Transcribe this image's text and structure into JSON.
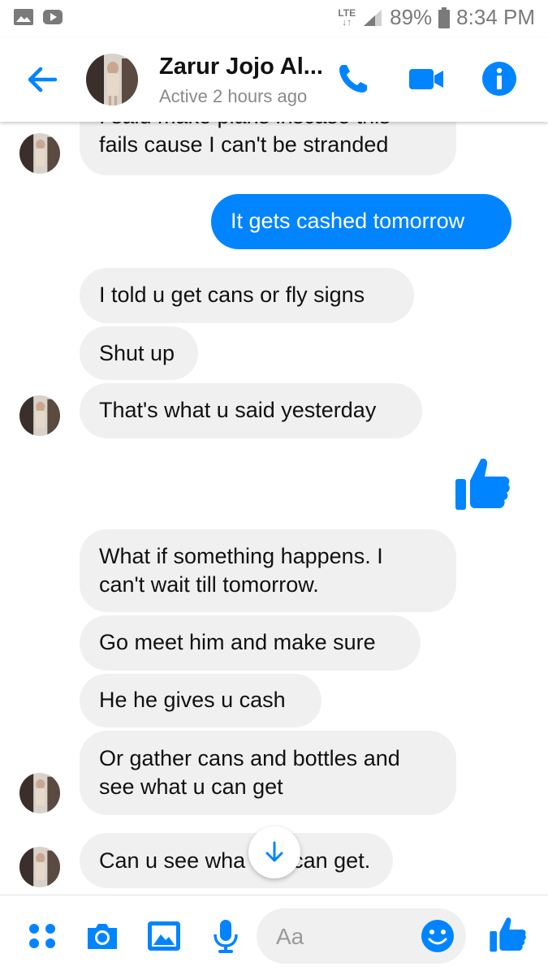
{
  "status_bar": {
    "network": "LTE",
    "battery": "89%",
    "time": "8:34 PM"
  },
  "header": {
    "name": "Zarur Jojo Al...",
    "status": "Active 2 hours ago"
  },
  "messages": [
    {
      "from": "them",
      "text": "I said make plans inscase this"
    },
    {
      "from": "them",
      "text": "fails cause I can't be stranded"
    },
    {
      "from": "me",
      "text": "It gets cashed tomorrow"
    },
    {
      "from": "them",
      "text": "I told u get cans or fly signs"
    },
    {
      "from": "them",
      "text": "Shut up"
    },
    {
      "from": "them",
      "text": "That's what u said yesterday"
    },
    {
      "from": "me",
      "type": "like-sticker"
    },
    {
      "from": "them",
      "text": "What if something happens. I"
    },
    {
      "from": "them",
      "text": "can't wait till tomorrow."
    },
    {
      "from": "them",
      "text": "Go meet him and make sure"
    },
    {
      "from": "them",
      "text": "He he gives u cash"
    },
    {
      "from": "them",
      "text": "Or gather cans and bottles and"
    },
    {
      "from": "them",
      "text": "see what u can get"
    },
    {
      "from": "them",
      "text": "Can u see wha"
    },
    {
      "from": "them",
      "text": "can get."
    }
  ],
  "composer": {
    "placeholder": "Aa"
  },
  "colors": {
    "accent": "#0084ff",
    "incoming_bubble": "#f0f0f0",
    "status_text": "#8a8a8a"
  },
  "icons": [
    "gallery-icon",
    "youtube-icon",
    "signal-icon",
    "battery-icon",
    "back-arrow-icon",
    "phone-icon",
    "video-icon",
    "info-icon",
    "scroll-down-icon",
    "more-icon",
    "camera-icon",
    "image-icon",
    "microphone-icon",
    "emoji-icon",
    "thumbs-up-icon"
  ]
}
